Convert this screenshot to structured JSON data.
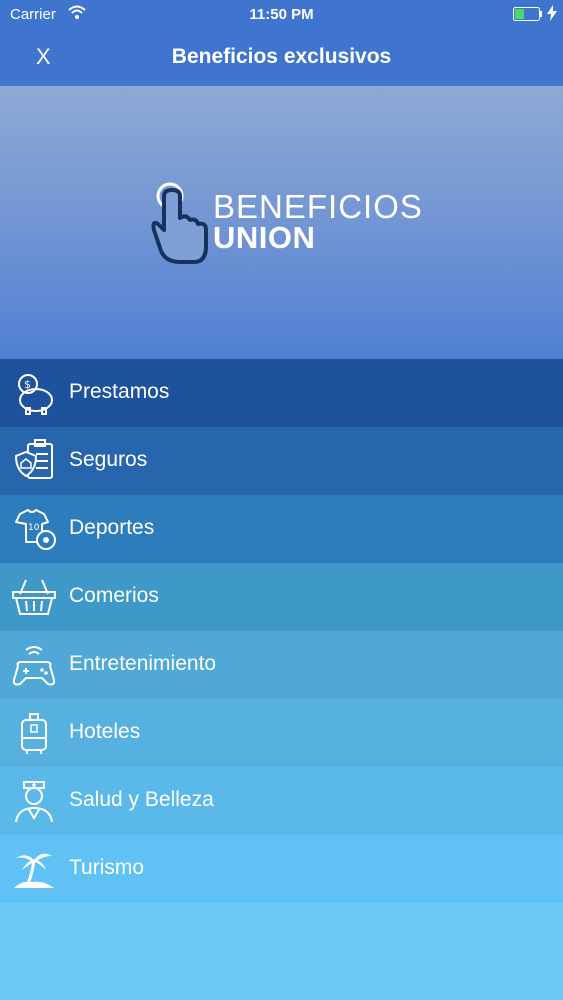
{
  "status_bar": {
    "carrier": "Carrier",
    "time": "11:50 PM"
  },
  "nav": {
    "close_label": "X",
    "title": "Beneficios exclusivos"
  },
  "hero": {
    "logo_line1": "BENEFICIOS",
    "logo_line2": "UNION"
  },
  "menu": {
    "items": [
      {
        "label": "Prestamos",
        "icon": "piggy-bank-icon",
        "color": "#1f529d"
      },
      {
        "label": "Seguros",
        "icon": "insurance-icon",
        "color": "#2766ad"
      },
      {
        "label": "Deportes",
        "icon": "sports-icon",
        "color": "#2d7dbc"
      },
      {
        "label": "Comerios",
        "icon": "shopping-basket-icon",
        "color": "#3f99c8"
      },
      {
        "label": "Entretenimiento",
        "icon": "gamepad-icon",
        "color": "#4fa8d6"
      },
      {
        "label": "Hoteles",
        "icon": "luggage-icon",
        "color": "#56b1e1"
      },
      {
        "label": "Salud y Belleza",
        "icon": "nurse-icon",
        "color": "#5bb9ea"
      },
      {
        "label": "Turismo",
        "icon": "palm-island-icon",
        "color": "#60c1f4"
      }
    ]
  }
}
